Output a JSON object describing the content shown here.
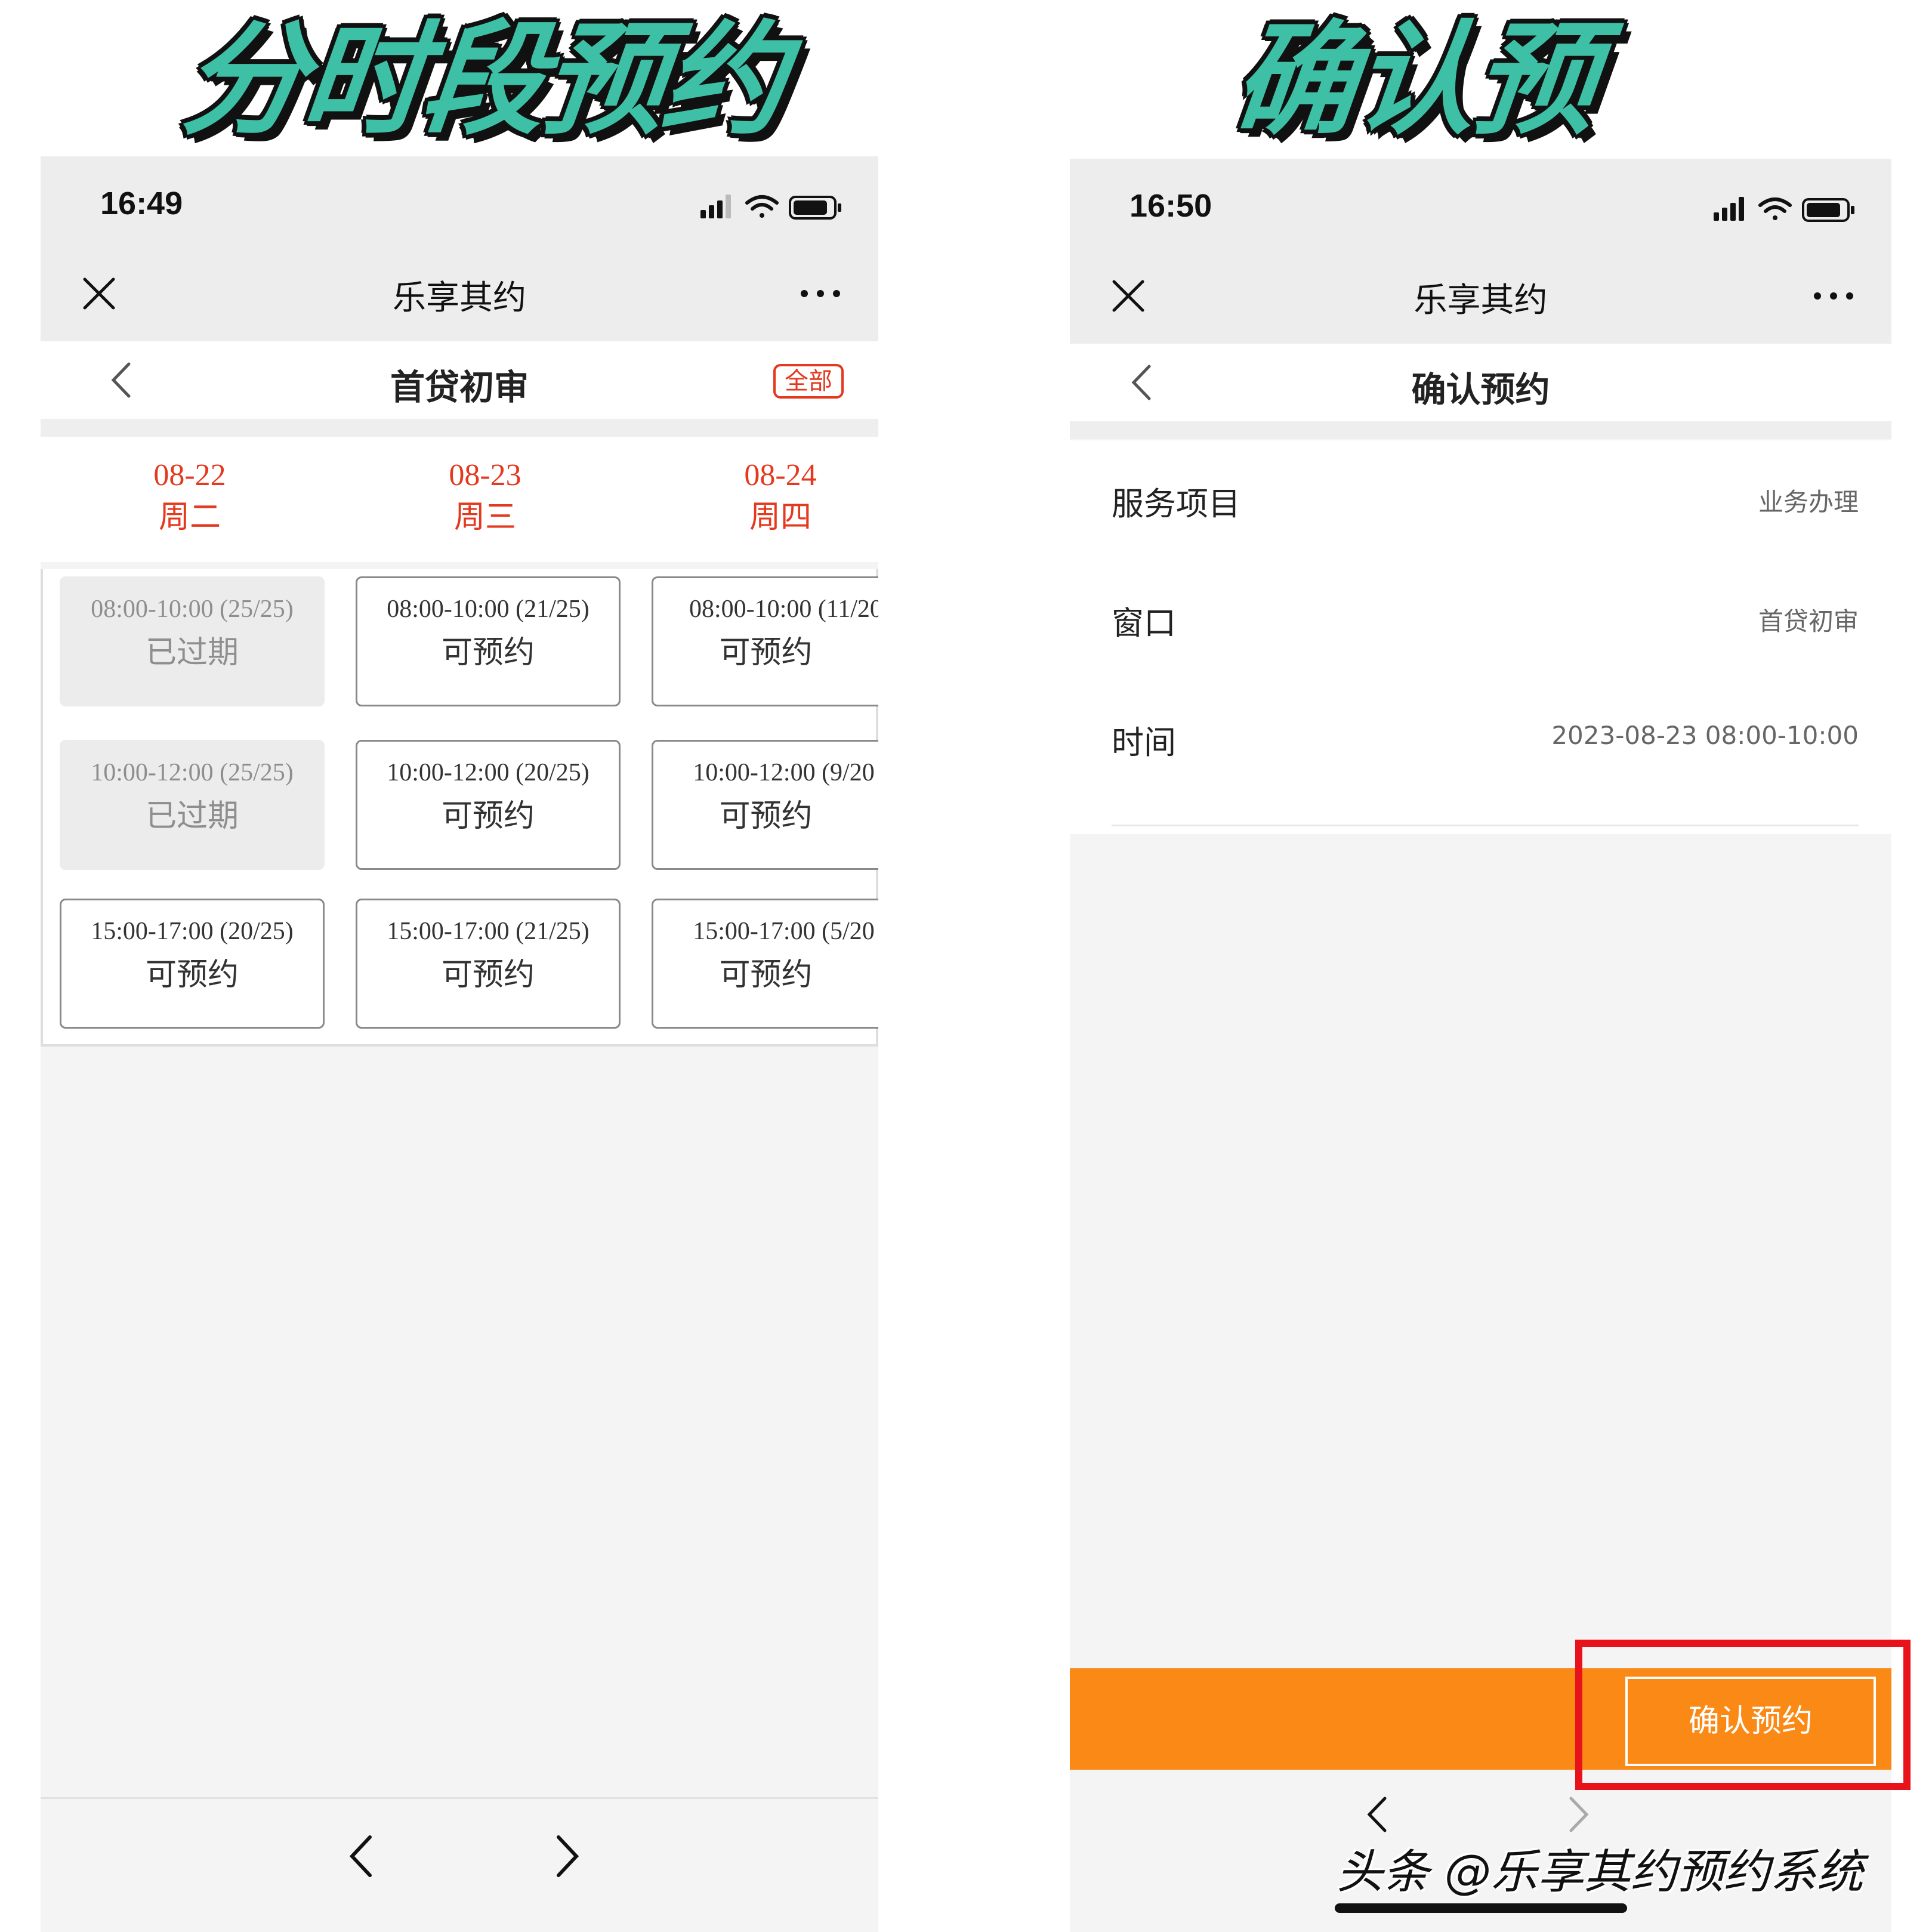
{
  "captions": {
    "left": "分时段预约",
    "right": "确认预约"
  },
  "left_phone": {
    "status_time": "16:49",
    "app_title": "乐享其约",
    "page_title": "首贷初审",
    "all_button": "全部",
    "dates": [
      {
        "date": "08-22",
        "weekday": "周二"
      },
      {
        "date": "08-23",
        "weekday": "周三"
      },
      {
        "date": "08-24",
        "weekday": "周四"
      }
    ],
    "slots": [
      [
        {
          "range": "08:00-10:00 (25/25)",
          "state": "已过期"
        },
        {
          "range": "08:00-10:00 (21/25)",
          "state": "可预约"
        },
        {
          "range": "08:00-10:00 (11/20",
          "state": "可预约"
        }
      ],
      [
        {
          "range": "10:00-12:00 (25/25)",
          "state": "已过期"
        },
        {
          "range": "10:00-12:00 (20/25)",
          "state": "可预约"
        },
        {
          "range": "10:00-12:00 (9/20",
          "state": "可预约"
        }
      ],
      [
        {
          "range": "15:00-17:00 (20/25)",
          "state": "可预约"
        },
        {
          "range": "15:00-17:00 (21/25)",
          "state": "可预约"
        },
        {
          "range": "15:00-17:00 (5/20",
          "state": "可预约"
        }
      ]
    ]
  },
  "right_phone": {
    "status_time": "16:50",
    "app_title": "乐享其约",
    "page_title": "确认预约",
    "info": [
      {
        "label": "服务项目",
        "value": "业务办理"
      },
      {
        "label": "窗口",
        "value": "首贷初审"
      },
      {
        "label": "时间",
        "value": "2023-08-23 08:00-10:00"
      }
    ],
    "confirm_button": "确认预约"
  },
  "watermark": "头条 @乐享其约预约系统",
  "colors": {
    "accent_red": "#e4391e",
    "confirm_orange": "#fa8916",
    "caption_green": "#3ec0a6",
    "highlight_red": "#e8121b"
  },
  "icons": [
    "close-icon",
    "more-icon",
    "back-icon",
    "signal-icon",
    "wifi-icon",
    "battery-icon",
    "chevron-left-icon",
    "chevron-right-icon"
  ]
}
